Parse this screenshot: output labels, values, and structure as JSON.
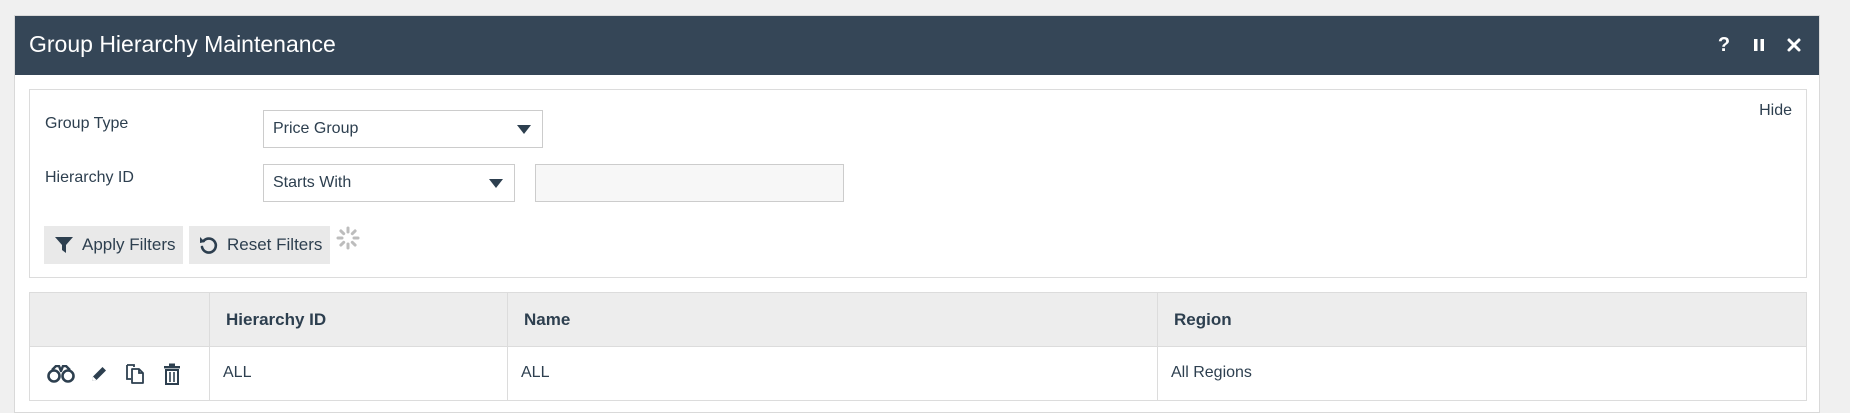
{
  "window": {
    "title": "Group Hierarchy Maintenance",
    "controls": {
      "help_label": "?",
      "pause_icon": "pause-icon",
      "close_icon": "close-icon"
    }
  },
  "filters": {
    "hide_label": "Hide",
    "group_type": {
      "label": "Group Type",
      "selected": "Price Group"
    },
    "hierarchy_id": {
      "label": "Hierarchy ID",
      "operator": "Starts With",
      "value": ""
    },
    "apply_label": "Apply Filters",
    "reset_label": "Reset Filters"
  },
  "grid": {
    "columns": [
      "",
      "Hierarchy ID",
      "Name",
      "Region"
    ],
    "rows": [
      {
        "actions": [
          "view-icon",
          "edit-icon",
          "copy-icon",
          "delete-icon"
        ],
        "hierarchy_id": "ALL",
        "name": "ALL",
        "region": "All Regions"
      }
    ]
  },
  "colors": {
    "titlebar": "#354657",
    "text": "#2d3f4f",
    "header_bg": "#ededed",
    "button_bg": "#e9e9e9"
  }
}
